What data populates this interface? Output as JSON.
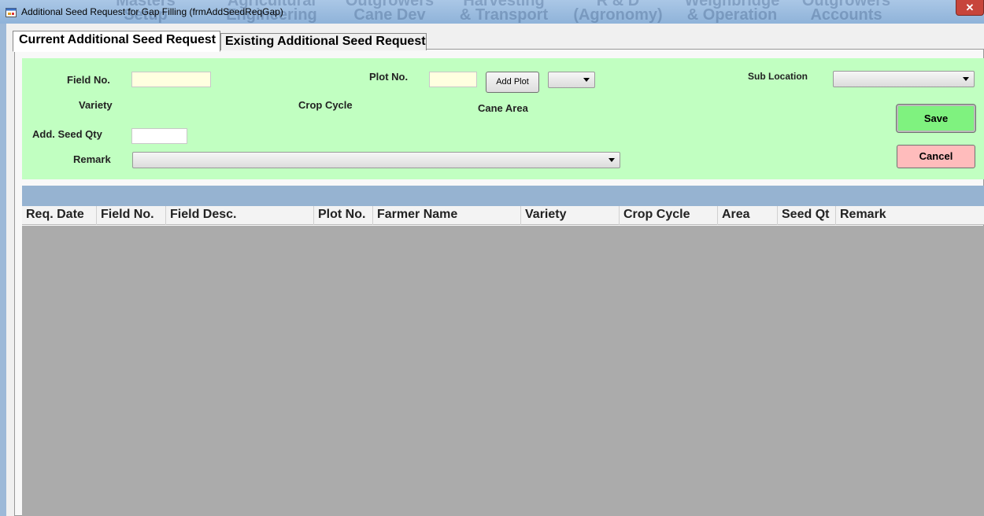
{
  "window": {
    "title": "Additional Seed Request  for Gap Filling (frmAddSeedReqGap)",
    "close_label": "✕",
    "background_menu": [
      [
        "Masters",
        "Setup"
      ],
      [
        "Agricultural",
        "Engineering"
      ],
      [
        "Outgrowers",
        "Cane Dev"
      ],
      [
        "Harvesting",
        "& Transport"
      ],
      [
        "R & D",
        "(Agronomy)"
      ],
      [
        "Weighbridge",
        "& Operation"
      ],
      [
        "Outgrowers",
        "Accounts"
      ]
    ]
  },
  "tabs": [
    {
      "label": "Current Additional Seed Request",
      "selected": true
    },
    {
      "label": "Existing Additional Seed Request",
      "selected": false
    }
  ],
  "form": {
    "field_no_label": "Field No.",
    "field_no_value": "",
    "plot_no_label": "Plot No.",
    "plot_no_value": "",
    "add_plot_label": "Add Plot",
    "sub_location_label": "Sub Location",
    "variety_label": "Variety",
    "crop_cycle_label": "Crop Cycle",
    "cane_area_label": "Cane Area",
    "add_seed_qty_label": "Add. Seed Qty",
    "add_seed_qty_value": "",
    "remark_label": "Remark",
    "save_label": "Save",
    "cancel_label": "Cancel"
  },
  "grid": {
    "columns": [
      "Req. Date",
      "Field No.",
      "Field Desc.",
      "Plot No.",
      "Farmer Name",
      "Variety",
      "Crop Cycle",
      "Area",
      "Seed Qt",
      "Remark"
    ],
    "rows": []
  },
  "colors": {
    "form_background": "#c1ffc1",
    "save_button": "#7ff27f",
    "cancel_button": "#ffbcbc",
    "grid_bar": "#96b3d1",
    "grid_body": "#ababab",
    "input_highlight": "#ffffe0"
  }
}
